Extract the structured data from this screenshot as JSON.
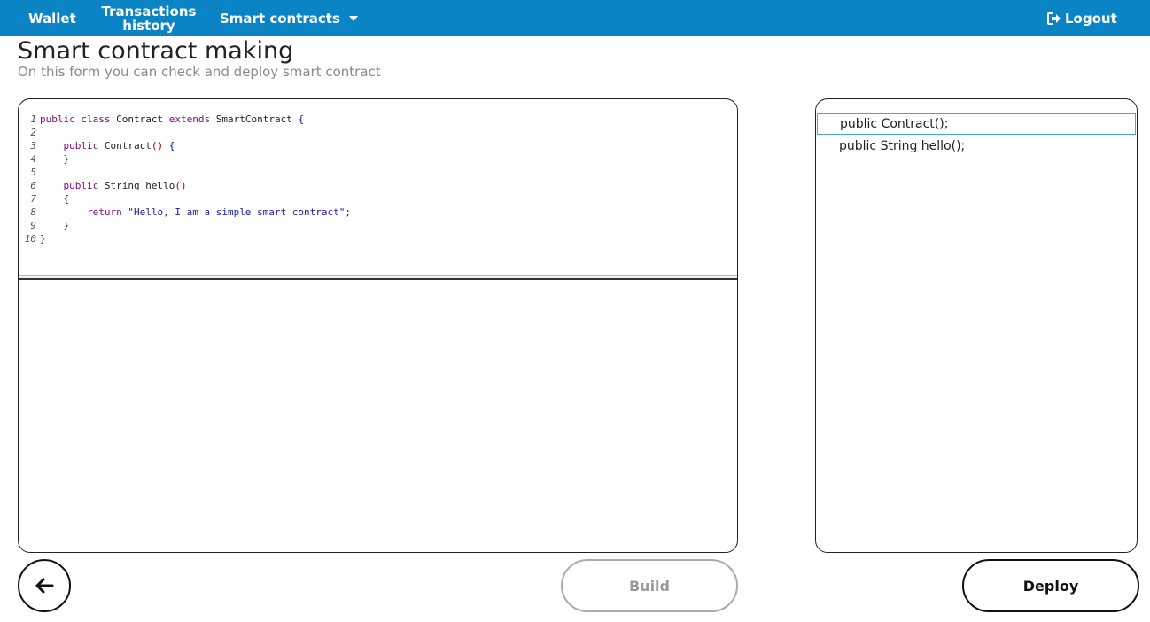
{
  "nav": {
    "wallet": "Wallet",
    "transactions_line1": "Transactions",
    "transactions_line2": "history",
    "smart_contracts": "Smart contracts",
    "logout": "Logout"
  },
  "page": {
    "title": "Smart contract making",
    "subtitle": "On this form you can check and deploy smart contract"
  },
  "editor": {
    "lines": [
      {
        "no": "1",
        "code": "public class Contract extends SmartContract {"
      },
      {
        "no": "2",
        "code": ""
      },
      {
        "no": "3",
        "code": "    public Contract() {"
      },
      {
        "no": "4",
        "code": "    }"
      },
      {
        "no": "5",
        "code": ""
      },
      {
        "no": "6",
        "code": "    public String hello()"
      },
      {
        "no": "7",
        "code": "    {"
      },
      {
        "no": "8",
        "code": "        return \"Hello, I am a simple smart contract\";"
      },
      {
        "no": "9",
        "code": "    }"
      },
      {
        "no": "10",
        "code": "}"
      }
    ]
  },
  "methods": [
    {
      "label": "public Contract();",
      "selected": true
    },
    {
      "label": "public String hello();",
      "selected": false
    }
  ],
  "buttons": {
    "build": "Build",
    "deploy": "Deploy"
  },
  "colors": {
    "topbar": "#0b84c6",
    "keyword": "#7a0a7a",
    "string": "#1a1aa6",
    "selected_border": "#4aa3d6"
  },
  "icons": {
    "back": "arrow-left-icon",
    "logout": "logout-icon",
    "dropdown": "caret-down-icon"
  }
}
